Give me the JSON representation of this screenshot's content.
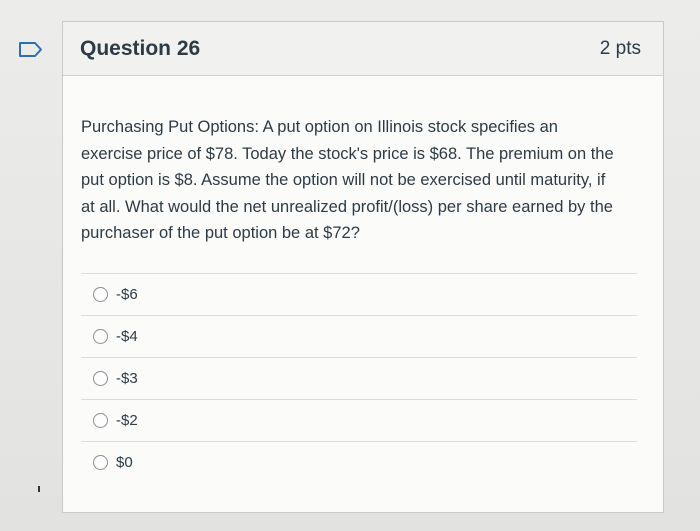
{
  "question": {
    "title": "Question 26",
    "points": "2 pts",
    "text": "Purchasing Put Options: A put option on Illinois stock specifies an exercise price of $78. Today the stock's price is $68. The premium on the put option is $8. Assume the option will not be exercised until maturity, if at all. What would the net unrealized profit/(loss) per share earned by the purchaser of the put option be at $72?",
    "answers": [
      {
        "label": "-$6"
      },
      {
        "label": "-$4"
      },
      {
        "label": "-$3"
      },
      {
        "label": "-$2"
      },
      {
        "label": "$0"
      }
    ]
  }
}
